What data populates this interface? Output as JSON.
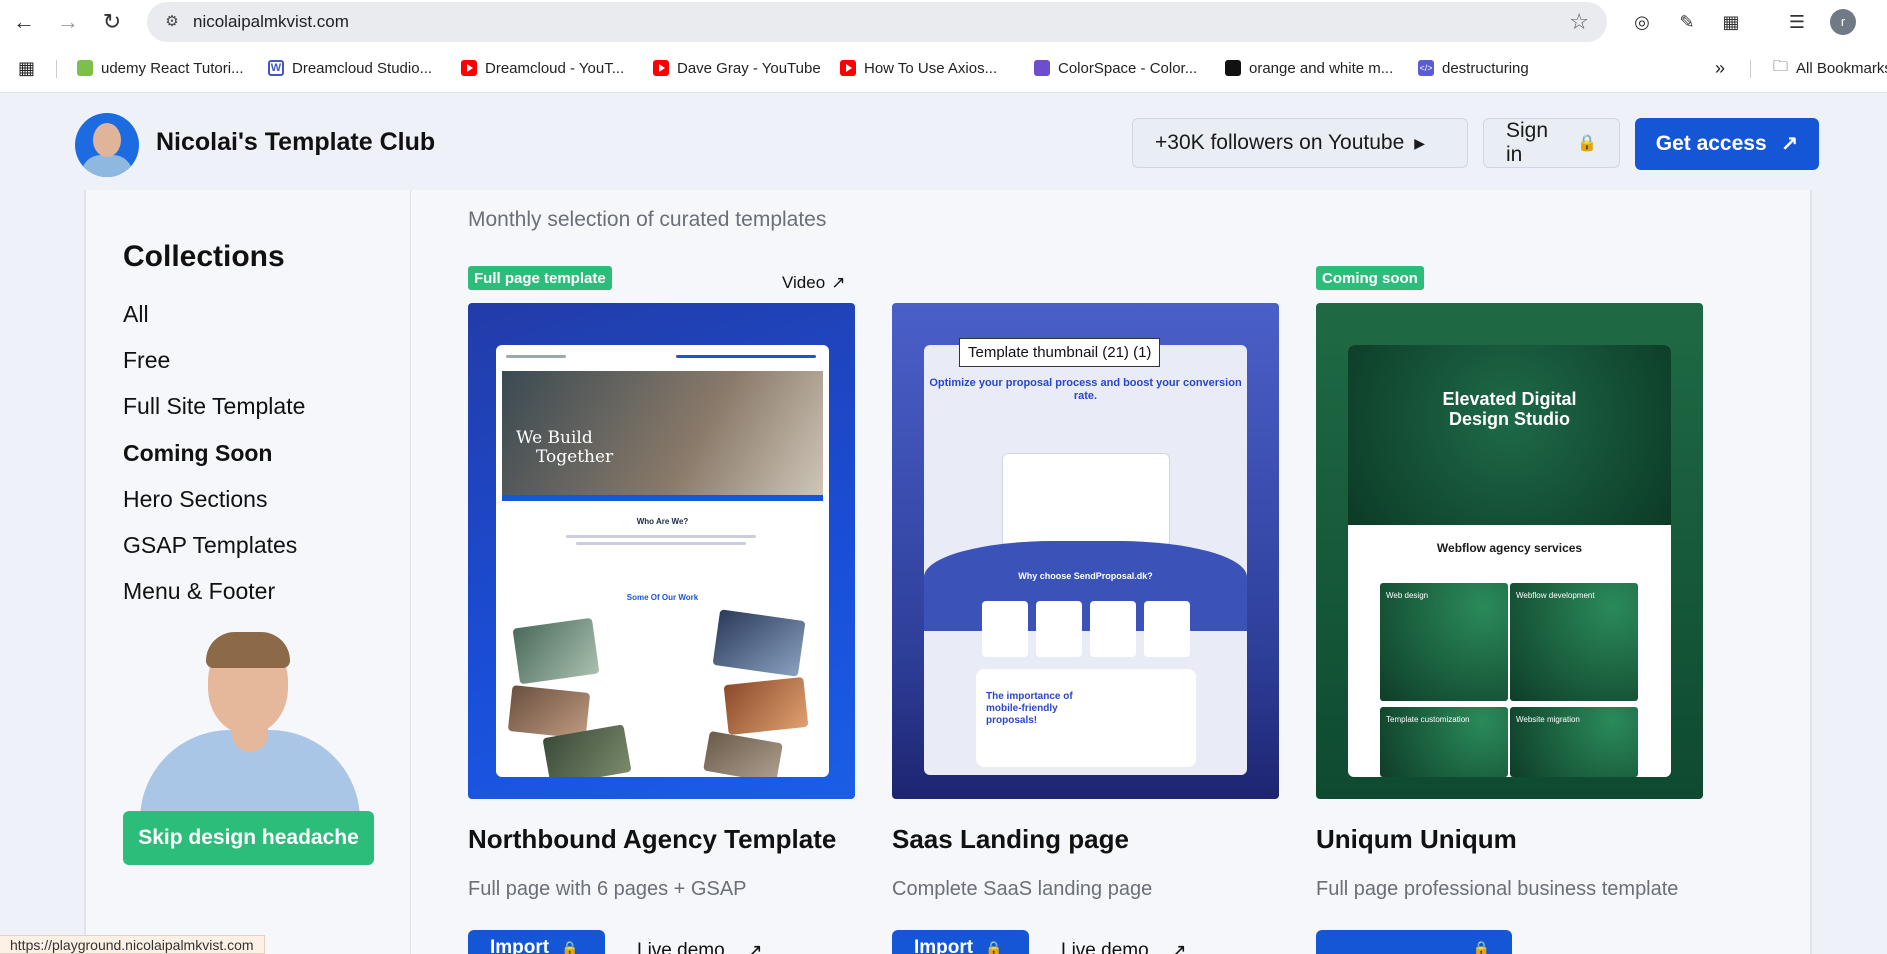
{
  "browser": {
    "url": "nicolaipalmkvist.com",
    "bookmarks": [
      {
        "label": "udemy React Tutori...",
        "icon": "udemy-icon"
      },
      {
        "label": "Dreamcloud Studio...",
        "icon": "w-icon"
      },
      {
        "label": "Dreamcloud - YouT...",
        "icon": "youtube-icon"
      },
      {
        "label": "Dave Gray - YouTube",
        "icon": "youtube-icon"
      },
      {
        "label": "How To Use Axios...",
        "icon": "youtube-icon"
      },
      {
        "label": "ColorSpace - Color...",
        "icon": "colorspace-icon"
      },
      {
        "label": "orange and white m...",
        "icon": "unsplash-icon"
      },
      {
        "label": "destructuring",
        "icon": "code-icon"
      },
      {
        "label": "All Bookmarks",
        "icon": "folder-icon"
      }
    ],
    "profile_initial": "r",
    "status_url": "https://playground.nicolaipalmkvist.com"
  },
  "header": {
    "site_title": "Nicolai's Template Club",
    "youtube_label": "+30K followers on Youtube",
    "signin_label": "Sign in",
    "access_label": "Get access"
  },
  "sidebar": {
    "title": "Collections",
    "items": [
      {
        "label": "All",
        "active": false
      },
      {
        "label": "Free",
        "active": false
      },
      {
        "label": "Full Site Template",
        "active": false
      },
      {
        "label": "Coming Soon",
        "active": true
      },
      {
        "label": "Hero Sections",
        "active": false
      },
      {
        "label": "GSAP Templates",
        "active": false
      },
      {
        "label": "Menu & Footer",
        "active": false
      }
    ],
    "cta_label": "Skip design headache"
  },
  "main": {
    "subtitle": "Monthly selection of curated templates",
    "tooltip": "Template thumbnail (21) (1)",
    "cards": [
      {
        "badge": "Full page template",
        "video_label": "Video",
        "title": "Northbound Agency Template",
        "description": "Full page with 6 pages + GSAP",
        "import_label": "Import",
        "demo_label": "Live demo",
        "thumb": {
          "hero_line1": "We Build",
          "hero_line2": "Together",
          "heading": "Who Are We?",
          "work": "Some Of Our Work"
        }
      },
      {
        "badge": "",
        "video_label": "",
        "title": "Saas Landing page",
        "description": "Complete SaaS landing page",
        "import_label": "Import",
        "demo_label": "Live demo",
        "thumb": {
          "hero": "Optimize your proposal process and boost your conversion rate.",
          "why": "Why choose SendProposal.dk?",
          "box": "The importance of mobile-friendly proposals!"
        }
      },
      {
        "badge": "Coming soon",
        "video_label": "",
        "title": "Uniqum Uniqum",
        "description": "Full page professional business template",
        "import_label": "",
        "demo_label": "",
        "thumb": {
          "hero": "Elevated Digital Design Studio",
          "services": "Webflow agency services",
          "s1": "Web design",
          "s2": "Webflow development",
          "s3": "Template customization",
          "s4": "Website migration"
        }
      }
    ]
  },
  "colors": {
    "primary": "#1456d6",
    "green": "#2dbd7a",
    "background": "#eef1f7"
  }
}
